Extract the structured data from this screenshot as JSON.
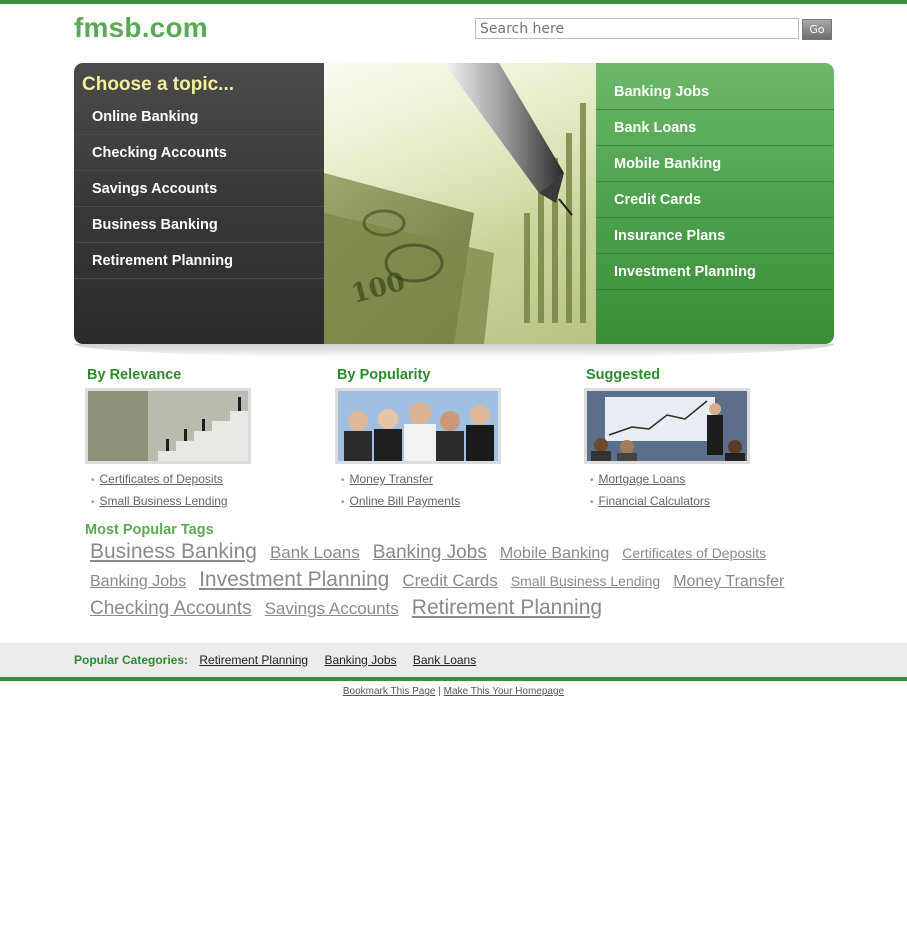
{
  "site": {
    "logo": "fmsb.com"
  },
  "search": {
    "placeholder": "Search here",
    "value": "",
    "button_label": "Go"
  },
  "hero": {
    "heading": "Choose a topic...",
    "left_topics": [
      "Online Banking",
      "Checking Accounts",
      "Savings Accounts",
      "Business Banking",
      "Retirement Planning"
    ],
    "right_topics": [
      "Banking Jobs",
      "Bank Loans",
      "Mobile Banking",
      "Credit Cards",
      "Insurance Plans",
      "Investment Planning"
    ]
  },
  "columns": [
    {
      "title": "By Relevance",
      "links": [
        "Certificates of Deposits",
        "Small Business Lending"
      ]
    },
    {
      "title": "By Popularity",
      "links": [
        "Money Transfer",
        "Online Bill Payments"
      ]
    },
    {
      "title": "Suggested",
      "links": [
        "Mortgage Loans",
        "Financial Calculators"
      ]
    }
  ],
  "tags": {
    "title": "Most Popular Tags",
    "rows": [
      [
        {
          "label": "Business Banking",
          "size": 21
        },
        {
          "label": "Bank Loans",
          "size": 17
        },
        {
          "label": "Banking Jobs",
          "size": 19
        },
        {
          "label": "Mobile Banking",
          "size": 16
        },
        {
          "label": "Certificates of Deposits",
          "size": 14
        }
      ],
      [
        {
          "label": "Banking Jobs",
          "size": 16
        },
        {
          "label": "Investment Planning",
          "size": 21
        },
        {
          "label": "Credit Cards",
          "size": 17
        },
        {
          "label": "Small Business Lending",
          "size": 14
        },
        {
          "label": "Money Transfer",
          "size": 16
        }
      ],
      [
        {
          "label": "Checking Accounts",
          "size": 19
        },
        {
          "label": "Savings Accounts",
          "size": 17
        },
        {
          "label": "Retirement Planning",
          "size": 21
        }
      ]
    ]
  },
  "categories": {
    "label": "Popular Categories:",
    "links": [
      "Retirement Planning",
      "Banking Jobs",
      "Bank Loans"
    ]
  },
  "footer": {
    "bookmark": "Bookmark This Page",
    "separator": "|",
    "homepage": "Make This Your Homepage"
  },
  "colors": {
    "brand_green": "#5aa955",
    "dark_green": "#2f8a2f",
    "heading_yellow": "#f2efa0",
    "tag_gray": "#8a8a8a"
  }
}
